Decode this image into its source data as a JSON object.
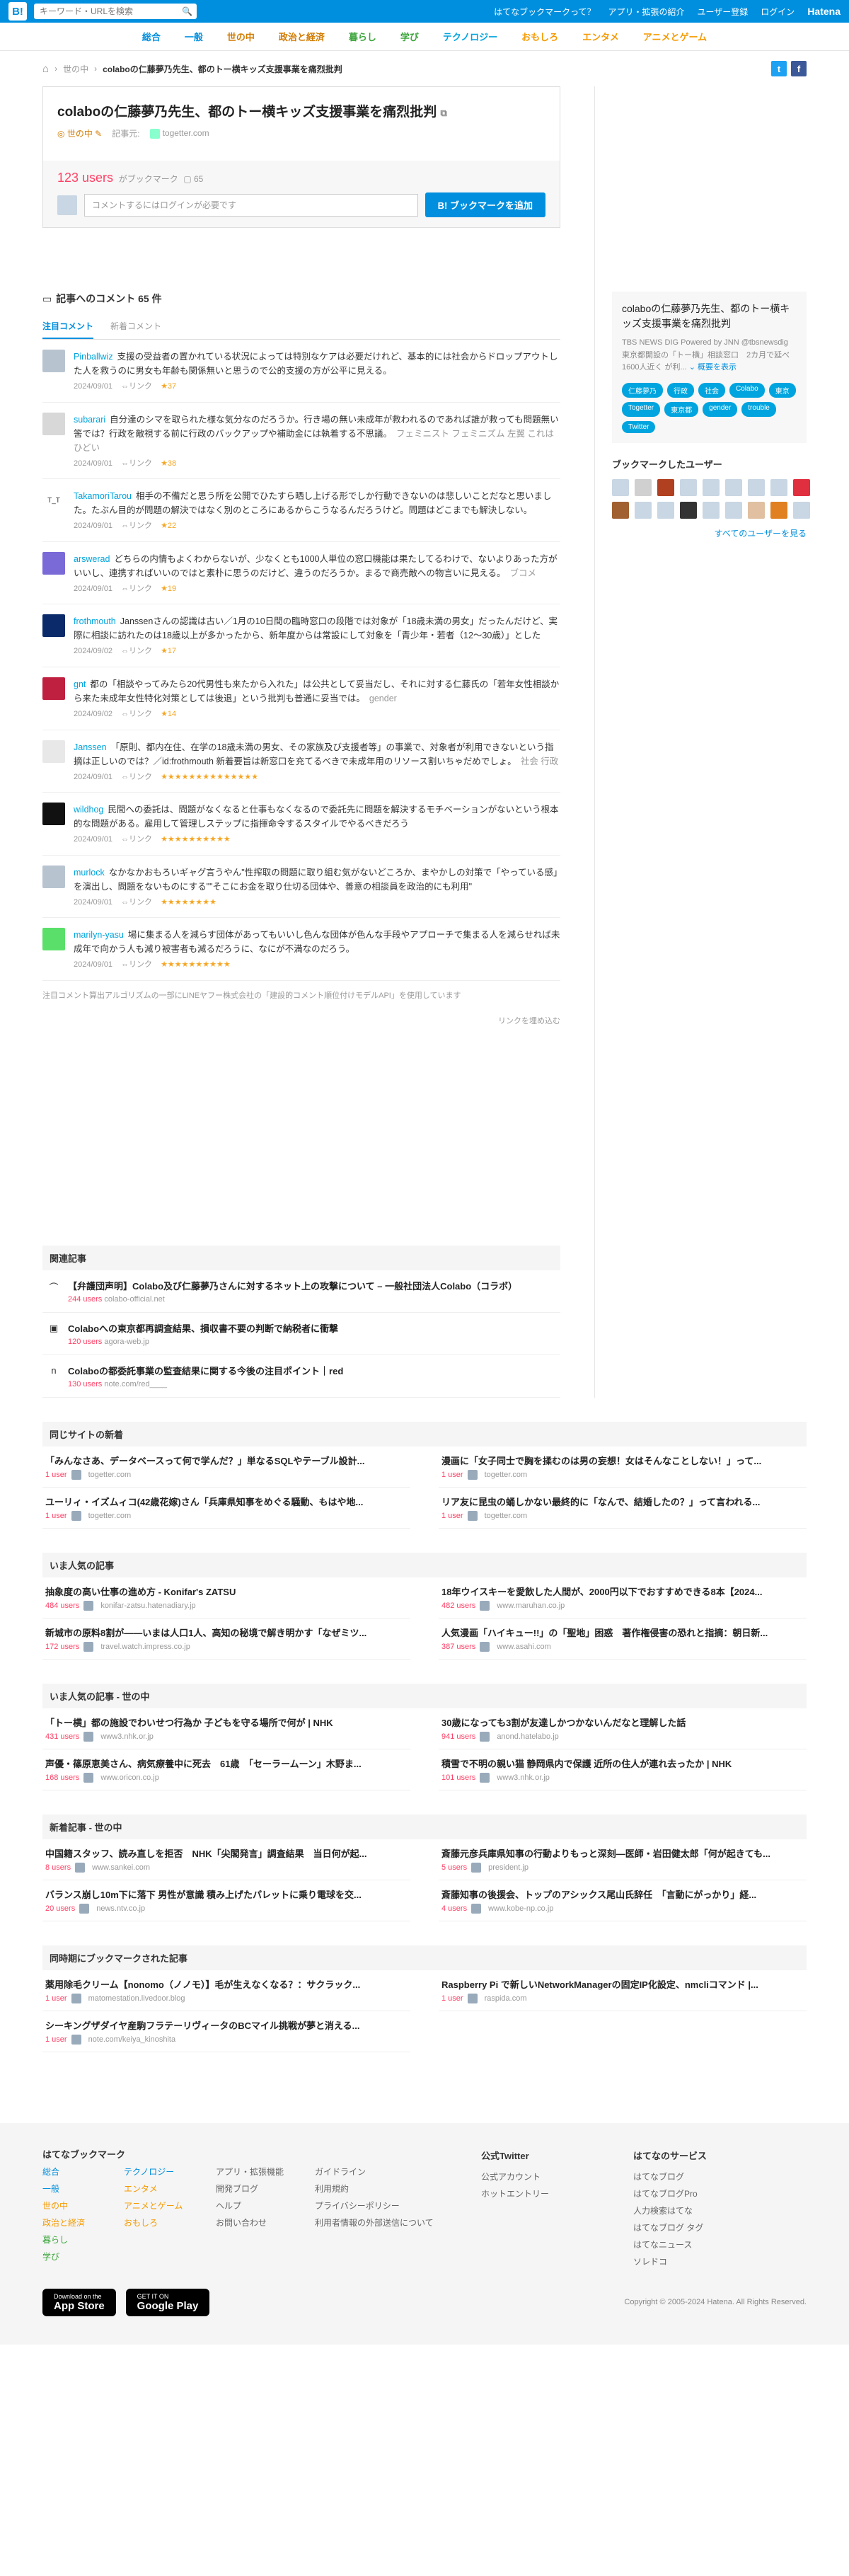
{
  "topbar": {
    "logo": "B!",
    "search_placeholder": "キーワード・URLを検索",
    "links": [
      "はてなブックマークって？",
      "アプリ・拡張の紹介",
      "ユーザー登録",
      "ログイン"
    ],
    "brand": "Hatena"
  },
  "categories": [
    "総合",
    "一般",
    "世の中",
    "政治と経済",
    "暮らし",
    "学び",
    "テクノロジー",
    "おもしろ",
    "エンタメ",
    "アニメとゲーム"
  ],
  "breadcrumb": {
    "home": "ホーム",
    "section": "世の中",
    "title": "colaboの仁藤夢乃先生、都のトー横キッズ支援事業を痛烈批判"
  },
  "entry": {
    "title": "colaboの仁藤夢乃先生、都のトー横キッズ支援事業を痛烈批判",
    "category": "世の中",
    "source_label": "記事元:",
    "source": "togetter.com",
    "users": "123 users",
    "bm_label": "がブックマーク",
    "comment_count": "65",
    "comment_placeholder": "コメントするにはログインが必要です",
    "add_button": "B! ブックマークを追加"
  },
  "comments_section": {
    "heading": "記事へのコメント 65 件",
    "tabs": [
      "注目コメント",
      "新着コメント"
    ]
  },
  "comments": [
    {
      "user": "Pinballwiz",
      "text": "支援の受益者の置かれている状況によっては特別なケアは必要だけれど、基本的には社会からドロップアウトした人を救うのに男女も年齢も関係無いと思うので公的支援の方が公平に見える。",
      "tags": "",
      "date": "2024/09/01",
      "stars": "★37",
      "color": "#b7c4d0"
    },
    {
      "user": "subarari",
      "text": "自分達のシマを取られた様な気分なのだろうか。行き場の無い未成年が救われるのであれば誰が救っても問題無い筈では？行政を敵視する前に行政のバックアップや補助金には執着する不思議。",
      "tags": "フェミニスト フェミニズム 左翼 これはひどい",
      "date": "2024/09/01",
      "stars": "★38",
      "color": "#d8d8d8"
    },
    {
      "user": "TakamoriTarou",
      "text": "相手の不備だと思う所を公開でひたすら晒し上げる形でしか行動できないのは悲しいことだなと思いました。たぶん目的が問題の解決ではなく別のところにあるからこうなるんだろうけど。問題はどこまでも解決しない。",
      "tags": "",
      "date": "2024/09/01",
      "stars": "★22",
      "color": "#ffffff"
    },
    {
      "user": "arswerad",
      "text": "どちらの内情もよくわからないが、少なくとも1000人単位の窓口機能は果たしてるわけで、ないよりあった方がいいし、連携すればいいのではと素朴に思うのだけど、違うのだろうか。まるで商売敵への物言いに見える。",
      "tags": "ブコメ",
      "date": "2024/09/01",
      "stars": "★19",
      "color": "#7a6ad8"
    },
    {
      "user": "frothmouth",
      "text": "Janssenさんの認識は古い／1月の10日間の臨時窓口の段階では対象が「18歳未満の男女」だったんだけど、実際に相談に訪れたのは18歳以上が多かったから、新年度からは常設にして対象を「青少年・若者（12〜30歳）」とした",
      "tags": "",
      "date": "2024/09/02",
      "stars": "★17",
      "color": "#0a2a6a"
    },
    {
      "user": "gnt",
      "text": "都の「相談やってみたら20代男性も来たから入れた」は公共として妥当だし、それに対する仁藤氏の「若年女性相談から来た未成年女性特化対策としては後退」という批判も普通に妥当では。",
      "tags": "gender",
      "date": "2024/09/02",
      "stars": "★14",
      "color": "#c02040"
    },
    {
      "user": "Janssen",
      "text": "「原則、都内在住、在学の18歳未満の男女、その家族及び支援者等」の事業で、対象者が利用できないという指摘は正しいのでは？／id:frothmouth 新着要旨は新窓口を充てるべきで未成年用のリソース割いちゃだめでしょ。",
      "tags": "社会 行政",
      "date": "2024/09/01",
      "stars": "★★★★★★★★★★★★★★",
      "color": "#e8e8e8"
    },
    {
      "user": "wildhog",
      "text": "民間への委託は、問題がなくなると仕事もなくなるので委託先に問題を解決するモチベーションがないという根本的な問題がある。雇用して管理しステップに指揮命令するスタイルでやるべきだろう",
      "tags": "",
      "date": "2024/09/01",
      "stars": "★★★★★★★★★★",
      "color": "#111111"
    },
    {
      "user": "murlock",
      "text": "なかなかおもろいギャグ言うやん\"性搾取の問題に取り組む気がないどころか、まやかしの対策で「やっている感」を演出し、問題をないものにする\"\"そこにお金を取り仕切る団体や、善意の相談員を政治的にも利用\"",
      "tags": "",
      "date": "2024/09/01",
      "stars": "★★★★★★★★",
      "color": "#b7c4d0"
    },
    {
      "user": "marilyn-yasu",
      "text": "場に集まる人を減らす団体があってもいいし色んな団体が色んな手段やアプローチで集まる人を減らせれば未成年で向かう人も減り被害者も減るだろうに、なにが不満なのだろう。",
      "tags": "",
      "date": "2024/09/01",
      "stars": "★★★★★★★★★★",
      "color": "#5ae06a"
    }
  ],
  "ai_note": "注目コメント算出アルゴリズムの一部にLINEヤフー株式会社の「建設的コメント順位付けモデルAPI」を使用しています",
  "embed_link": "リンクを埋め込む",
  "related": {
    "heading": "関連記事",
    "items": [
      {
        "title": "【弁護団声明】Colabo及び仁藤夢乃さんに対するネット上の攻撃について – 一般社団法人Colabo（コラボ）",
        "users": "244 users",
        "domain": "colabo-official.net",
        "icon": "⌒"
      },
      {
        "title": "Colaboへの東京都再調査結果、損収書不要の判断で納税者に衝撃",
        "users": "120 users",
        "domain": "agora-web.jp",
        "icon": "▣"
      },
      {
        "title": "Colaboの都委託事業の監査結果に関する今後の注目ポイント｜red",
        "users": "130 users",
        "domain": "note.com/red____",
        "icon": "n"
      }
    ]
  },
  "sidebar": {
    "title": "colaboの仁藤夢乃先生、都のトー横キッズ支援事業を痛烈批判",
    "desc": "TBS NEWS DIG Powered by JNN @tbsnewsdig 東京都開設の「トー横」相談窓口　2カ月で延べ1600人近く が利...",
    "more": "概要を表示",
    "tags": [
      "仁藤夢乃",
      "行政",
      "社会",
      "Colabo",
      "東京",
      "Togetter",
      "東京都",
      "gender",
      "trouble",
      "Twitter"
    ],
    "users_heading": "ブックマークしたユーザー",
    "all_users": "すべてのユーザーを見る"
  },
  "sections": [
    {
      "heading": "同じサイトの新着",
      "items": [
        {
          "title": "「みんなさあ、データベースって何で学んだ？」単なるSQLやテーブル設計...",
          "users": "1 user",
          "domain": "togetter.com"
        },
        {
          "title": "漫画に「女子同士で胸を揉むのは男の妄想！女はそんなことしない！」って...",
          "users": "1 user",
          "domain": "togetter.com"
        },
        {
          "title": "ユーリィ・イズムィコ(42歳花嫁)さん「兵庫県知事をめぐる騒動、もはや地...",
          "users": "1 user",
          "domain": "togetter.com"
        },
        {
          "title": "リア友に昆虫の蛹しかない最終的に「なんで、結婚したの？」って言われる...",
          "users": "1 user",
          "domain": "togetter.com"
        }
      ]
    },
    {
      "heading": "いま人気の記事",
      "items": [
        {
          "title": "抽象度の高い仕事の進め方 - Konifar's ZATSU",
          "users": "484 users",
          "domain": "konifar-zatsu.hatenadiary.jp"
        },
        {
          "title": "18年ウイスキーを愛飲した人間が、2000円以下でおすすめできる8本【2024...",
          "users": "482 users",
          "domain": "www.maruhan.co.jp"
        },
        {
          "title": "新城市の原料8割が――いまは人口1人、高知の秘境で解き明かす「なぜミツ...",
          "users": "172 users",
          "domain": "travel.watch.impress.co.jp"
        },
        {
          "title": "人気漫画「ハイキュー!!」の「聖地」困惑　著作権侵害の恐れと指摘：朝日新...",
          "users": "387 users",
          "domain": "www.asahi.com"
        }
      ]
    },
    {
      "heading": "いま人気の記事 - 世の中",
      "items": [
        {
          "title": "「トー横」都の施設でわいせつ行為か 子どもを守る場所で何が | NHK",
          "users": "431 users",
          "domain": "www3.nhk.or.jp"
        },
        {
          "title": "30歳になっても3割が友達しかつかないんだなと理解した話",
          "users": "941 users",
          "domain": "anond.hatelabo.jp"
        },
        {
          "title": "声優・篠原恵美さん、病気療養中に死去　61歳　「セーラームーン」木野ま...",
          "users": "168 users",
          "domain": "www.oricon.co.jp"
        },
        {
          "title": "積雪で不明の親い猫 静岡県内で保護 近所の住人が連れ去ったか | NHK",
          "users": "101 users",
          "domain": "www3.nhk.or.jp"
        }
      ]
    },
    {
      "heading": "新着記事 - 世の中",
      "items": [
        {
          "title": "中国籍スタッフ、読み直しを拒否　NHK「尖閣発言」調査結果　当日何が起...",
          "users": "8 users",
          "domain": "www.sankei.com"
        },
        {
          "title": "斎藤元彦兵庫県知事の行動よりもっと深刻―医師・岩田健太郎「何が起きても...",
          "users": "5 users",
          "domain": "president.jp"
        },
        {
          "title": "バランス崩し10m下に落下 男性が意識 積み上げたパレットに乗り電球を交...",
          "users": "20 users",
          "domain": "news.ntv.co.jp"
        },
        {
          "title": "斎藤知事の後援会、トップのアシックス尾山氏辞任　「言動にがっかり」経...",
          "users": "4 users",
          "domain": "www.kobe-np.co.jp"
        }
      ]
    },
    {
      "heading": "同時期にブックマークされた記事",
      "items": [
        {
          "title": "薬用除毛クリーム【nonomo（ノノモ）】毛が生えなくなる？：サクラック...",
          "users": "1 user",
          "domain": "matomestation.livedoor.blog"
        },
        {
          "title": "Raspberry Pi で新しいNetworkManagerの固定IP化設定、nmcliコマンド |...",
          "users": "1 user",
          "domain": "raspida.com"
        },
        {
          "title": "シーキングザダイヤ産駒フラテーリヴィータのBCマイル挑戦が夢と消える...",
          "users": "1 user",
          "domain": "note.com/keiya_kinoshita"
        }
      ]
    }
  ],
  "footer": {
    "col1_head": "はてなブックマーク",
    "col1a": [
      "総合",
      "一般",
      "世の中",
      "政治と経済",
      "暮らし",
      "学び"
    ],
    "col1b": [
      "テクノロジー",
      "エンタメ",
      "アニメとゲーム",
      "おもしろ"
    ],
    "col2": [
      "アプリ・拡張機能",
      "開発ブログ",
      "ヘルプ",
      "お問い合わせ"
    ],
    "col3": [
      "ガイドライン",
      "利用規約",
      "プライバシーポリシー",
      "利用者情報の外部送信について"
    ],
    "twitter_head": "公式Twitter",
    "twitter": [
      "公式アカウント",
      "ホットエントリー"
    ],
    "services_head": "はてなのサービス",
    "services": [
      "はてなブログ",
      "はてなブログPro",
      "人力検索はてな",
      "はてなブログ タグ",
      "はてなニュース",
      "ソレドコ"
    ],
    "app_store_small": "Download on the",
    "app_store": "App Store",
    "google_small": "GET IT ON",
    "google": "Google Play",
    "copyright": "Copyright © 2005-2024 Hatena. All Rights Reserved."
  }
}
